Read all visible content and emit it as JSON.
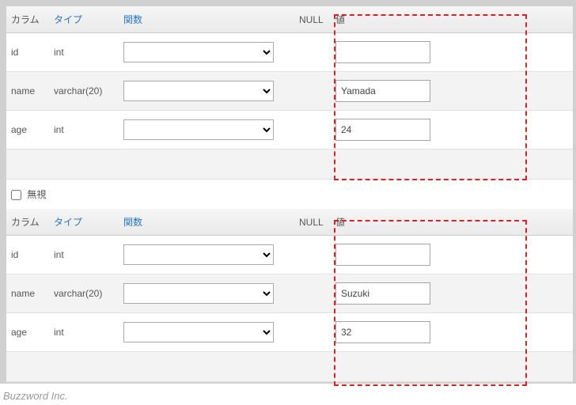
{
  "headers": {
    "column": "カラム",
    "type": "タイプ",
    "function": "関数",
    "null": "NULL",
    "value": "値"
  },
  "blocks": [
    {
      "rows": [
        {
          "name": "id",
          "type": "int",
          "value": ""
        },
        {
          "name": "name",
          "type": "varchar(20)",
          "value": "Yamada"
        },
        {
          "name": "age",
          "type": "int",
          "value": "24"
        }
      ]
    },
    {
      "rows": [
        {
          "name": "id",
          "type": "int",
          "value": ""
        },
        {
          "name": "name",
          "type": "varchar(20)",
          "value": "Suzuki"
        },
        {
          "name": "age",
          "type": "int",
          "value": "32"
        }
      ]
    }
  ],
  "ignore_label": "無視",
  "footer": "Buzzword Inc."
}
